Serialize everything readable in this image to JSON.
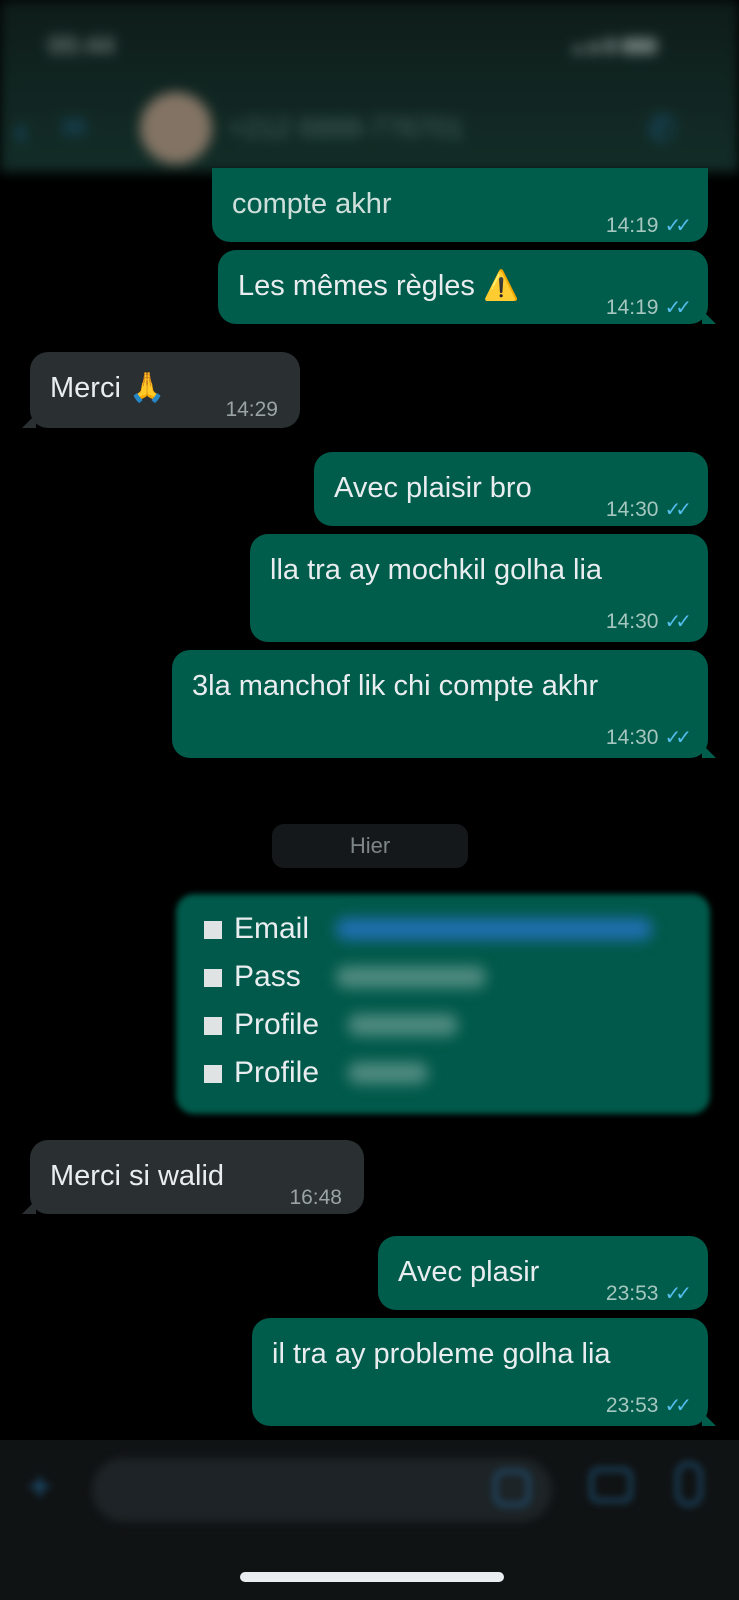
{
  "header": {
    "status_time": "00:44",
    "back_count": "36",
    "contact_name": "+212 6888-776701"
  },
  "messages": [
    {
      "text": "compte akhr",
      "time": "14:19",
      "direction": "out"
    },
    {
      "text": "Les mêmes règles ⚠️",
      "time": "14:19",
      "direction": "out"
    },
    {
      "text": "Merci 🙏",
      "time": "14:29",
      "direction": "in"
    },
    {
      "text": "Avec plaisir bro",
      "time": "14:30",
      "direction": "out"
    },
    {
      "text": "lla tra ay mochkil golha lia",
      "time": "14:30",
      "direction": "out"
    },
    {
      "text": "3la manchof lik chi compte akhr",
      "time": "14:30",
      "direction": "out"
    },
    {
      "text": "Merci si walid",
      "time": "16:48",
      "direction": "in"
    },
    {
      "text": "Avec plasir",
      "time": "23:53",
      "direction": "out"
    },
    {
      "text": "il tra ay probleme golha lia",
      "time": "23:53",
      "direction": "out"
    }
  ],
  "date_separator": "Hier",
  "credentials": {
    "items": [
      {
        "label": "Email"
      },
      {
        "label": "Pass"
      },
      {
        "label": "Profile"
      },
      {
        "label": "Profile"
      }
    ]
  },
  "read_ticks": "✓✓",
  "icons": {
    "back": "chevron-left-icon",
    "call": "phone-icon",
    "plus": "plus-icon",
    "sticker": "sticker-icon",
    "camera": "camera-icon",
    "mic": "microphone-icon"
  },
  "colors": {
    "outgoing_bubble": "#005c4b",
    "incoming_bubble": "#2a2f32",
    "tick": "#53bdeb",
    "background": "#000000"
  }
}
